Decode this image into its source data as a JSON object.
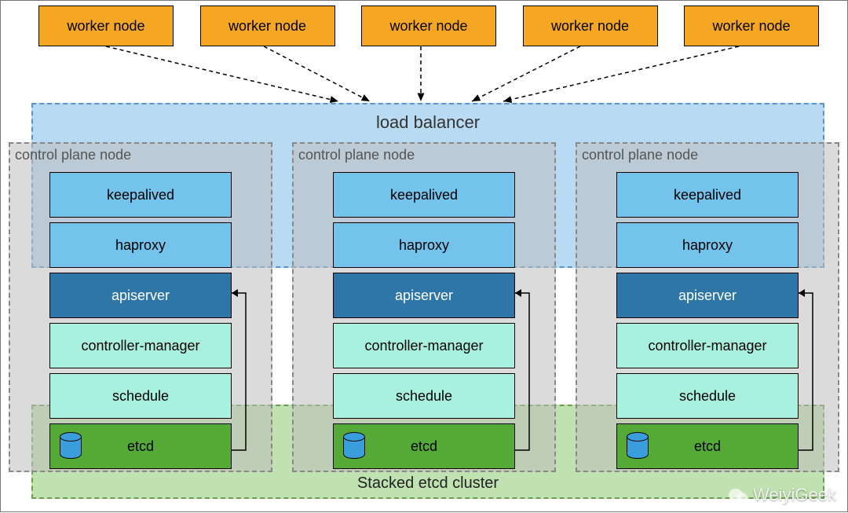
{
  "workers": [
    "worker node",
    "worker node",
    "worker node",
    "worker node",
    "worker node"
  ],
  "lb": {
    "label": "load balancer"
  },
  "etcd_cluster": {
    "label": "Stacked etcd cluster"
  },
  "cp_title": "control plane node",
  "stack": {
    "keepalived": "keepalived",
    "haproxy": "haproxy",
    "apiserver": "apiserver",
    "controller_manager": "controller-manager",
    "schedule": "schedule",
    "etcd": "etcd"
  },
  "watermark": "WeiyiGeek",
  "colors": {
    "worker": "#f5a623",
    "lb_box": "#74c3ec",
    "apiserver": "#2f76a8",
    "mint": "#a9f1df",
    "etcd": "#54a937",
    "etcd_zone": "#9ed186",
    "lb_zone": "#9acbec"
  }
}
